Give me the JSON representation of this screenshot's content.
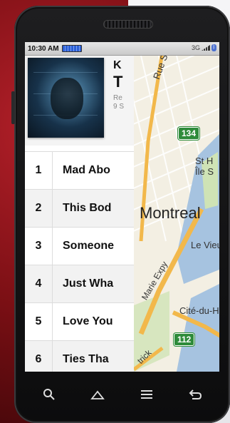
{
  "status_bar": {
    "time": "10:30 AM",
    "network": "3G",
    "icons": [
      "battery-icon",
      "signal-icon",
      "bluetooth-icon"
    ]
  },
  "album": {
    "artist_partial": "K",
    "title_partial": "T",
    "meta_line1_partial": "Re",
    "meta_line2_partial": "9 S"
  },
  "tracks": [
    {
      "number": "1",
      "name": "Mad Abo"
    },
    {
      "number": "2",
      "name": "This Bod"
    },
    {
      "number": "3",
      "name": "Someone"
    },
    {
      "number": "4",
      "name": "Just Wha"
    },
    {
      "number": "5",
      "name": "Love You"
    },
    {
      "number": "6",
      "name": "Ties Tha"
    }
  ],
  "map": {
    "labels": {
      "street": "Rue Sherbr",
      "city": "Montreal",
      "island_1": "St H",
      "island_2": "Île S",
      "vieux": "Le Vieu",
      "expy": "Marie Expy",
      "cite": "Cité-du-H",
      "patrick": "trick"
    },
    "shields": {
      "route_134": "134",
      "route_112": "112"
    }
  },
  "nav_bar": {
    "icons": [
      "search-icon",
      "home-icon",
      "menu-icon",
      "back-icon"
    ]
  },
  "colors": {
    "road_major": "#f2b84b",
    "water": "#a6c3e0",
    "park": "#cfe3b5",
    "shield": "#2e8b3a",
    "battery_fill": "#2b5fd6"
  }
}
